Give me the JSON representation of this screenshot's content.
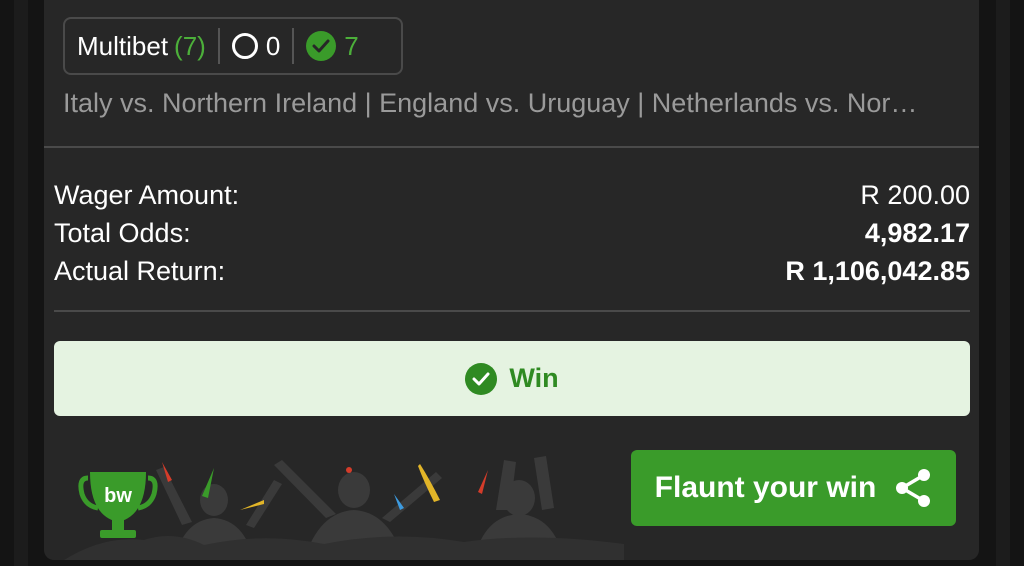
{
  "bet": {
    "type_label": "Multibet",
    "selection_count": "(7)",
    "open_count": "0",
    "won_count": "7",
    "events": "Italy vs. Northern Ireland | England vs. Uruguay | Netherlands vs. Nor…"
  },
  "summary": {
    "wager_label": "Wager Amount:",
    "wager_value": "R 200.00",
    "odds_label": "Total Odds:",
    "odds_value": "4,982.17",
    "return_label": "Actual Return:",
    "return_value": "R 1,106,042.85"
  },
  "result": {
    "label": "Win",
    "icon": "check-circle-icon"
  },
  "footer": {
    "logo_text": "bw",
    "flaunt_label": "Flaunt your win",
    "share_icon": "share-icon"
  },
  "colors": {
    "accent_green": "#3a9b2a",
    "win_bg": "#e5f3e1",
    "card_bg": "#272727"
  }
}
